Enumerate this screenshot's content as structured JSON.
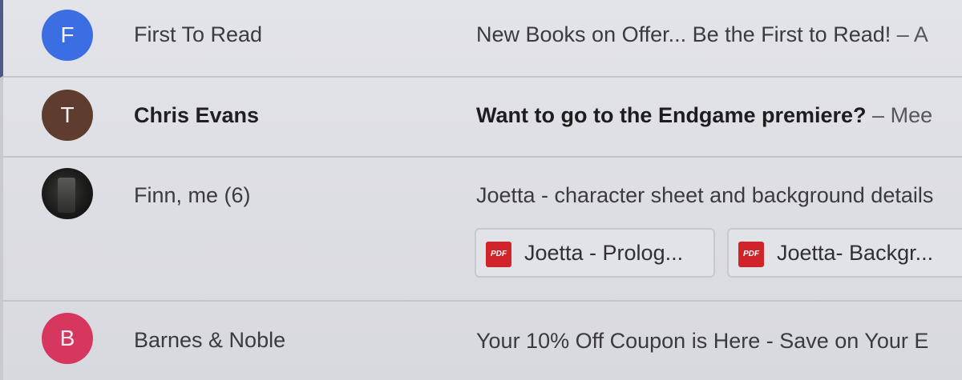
{
  "threads": [
    {
      "avatar_letter": "F",
      "sender": "First To Read",
      "subject": "New Books on Offer... Be the First to Read!",
      "separator": "–",
      "snippet": "A",
      "unread": false
    },
    {
      "avatar_letter": "T",
      "sender": "Chris Evans",
      "subject": "Want to go to the Endgame premiere?",
      "separator": "–",
      "snippet": "Mee",
      "unread": true
    },
    {
      "avatar_letter": "",
      "sender": "Finn, me (6)",
      "subject": "Joetta - character sheet and background details",
      "separator": "",
      "snippet": "",
      "unread": false,
      "attachments": [
        {
          "icon_text": "PDF",
          "name": "Joetta - Prolog..."
        },
        {
          "icon_text": "PDF",
          "name": "Joetta- Backgr..."
        }
      ]
    },
    {
      "avatar_letter": "B",
      "sender": "Barnes & Noble",
      "subject": "Your 10% Off Coupon is Here - Save on Your E",
      "separator": "",
      "snippet": "",
      "unread": false
    }
  ],
  "colors": {
    "avatar_first_to_read": "#3a6ee2",
    "avatar_chris_evans": "#5e3d2e",
    "avatar_barnes_noble": "#d7375f",
    "pdf_icon": "#d0242a",
    "background": "#dedfe5"
  },
  "icons": {
    "attachment": "pdf-icon"
  }
}
